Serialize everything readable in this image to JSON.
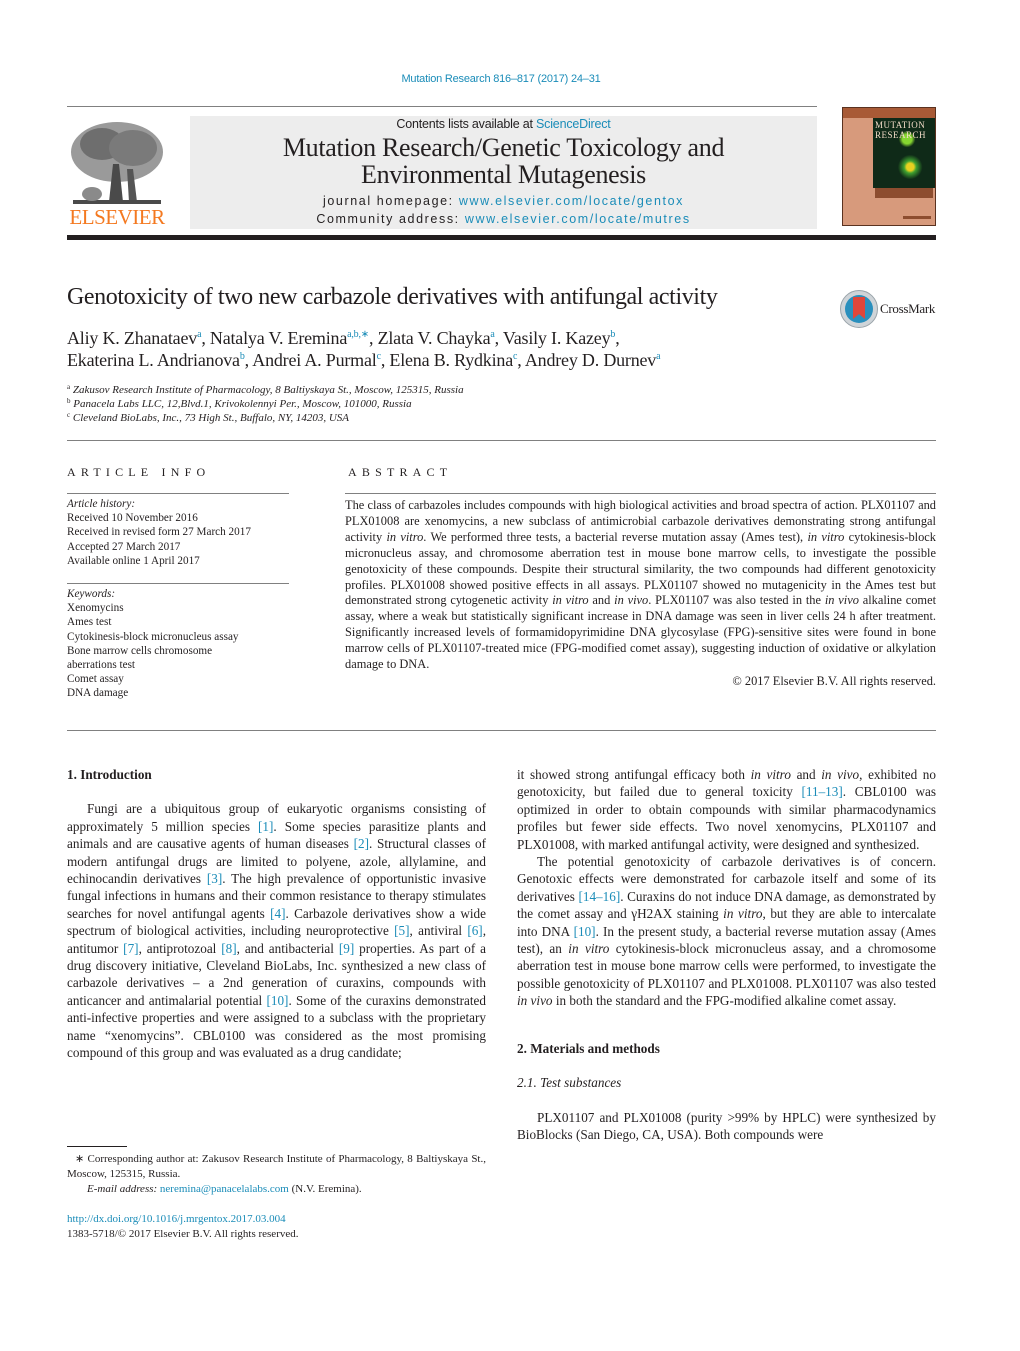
{
  "header": {
    "journal_ref": "Mutation Research 816–817 (2017) 24–31",
    "contents_prefix": "Contents lists available at ",
    "contents_link": "ScienceDirect",
    "journal_title_line1": "Mutation Research/Genetic Toxicology and",
    "journal_title_line2": "Environmental Mutagenesis",
    "homepage_label": "journal homepage: ",
    "homepage_url": "www.elsevier.com/locate/gentox",
    "community_label": "Community address: ",
    "community_url": "www.elsevier.com/locate/mutres",
    "publisher_logo_text": "ELSEVIER",
    "cover_title_line1": "MUTATION",
    "cover_title_line2": "RESEARCH"
  },
  "article": {
    "title": "Genotoxicity of two new carbazole derivatives with antifungal activity",
    "crossmark_label": "CrossMark",
    "authors": [
      {
        "name": "Aliy K. Zhanataev",
        "aff": "a",
        "sep": ", "
      },
      {
        "name": "Natalya V. Eremina",
        "aff": "a,b,∗",
        "sep": ", "
      },
      {
        "name": "Zlata V. Chayka",
        "aff": "a",
        "sep": ", "
      },
      {
        "name": "Vasily I. Kazey",
        "aff": "b",
        "sep": ","
      },
      {
        "name": "Ekaterina L. Andrianova",
        "aff": "b",
        "sep": ", "
      },
      {
        "name": "Andrei A. Purmal",
        "aff": "c",
        "sep": ", "
      },
      {
        "name": "Elena B. Rydkina",
        "aff": "c",
        "sep": ", "
      },
      {
        "name": "Andrey D. Durnev",
        "aff": "a",
        "sep": ""
      }
    ],
    "affiliations": [
      {
        "key": "a",
        "text": "Zakusov Research Institute of Pharmacology, 8 Baltiyskaya St., Moscow, 125315, Russia"
      },
      {
        "key": "b",
        "text": "Panacela Labs LLC, 12,Blvd.1, Krivokolennyi Per., Moscow, 101000, Russia"
      },
      {
        "key": "c",
        "text": "Cleveland BioLabs, Inc., 73 High St., Buffalo, NY, 14203, USA"
      }
    ]
  },
  "article_info": {
    "heading": "ARTICLE INFO",
    "history_label": "Article history:",
    "history": [
      "Received 10 November 2016",
      "Received in revised form 27 March 2017",
      "Accepted 27 March 2017",
      "Available online 1 April 2017"
    ],
    "keywords_label": "Keywords:",
    "keywords": [
      "Xenomycins",
      "Ames test",
      "Cytokinesis-block micronucleus assay",
      "Bone marrow cells chromosome",
      "aberrations test",
      "Comet assay",
      "DNA damage"
    ]
  },
  "abstract": {
    "heading": "ABSTRACT",
    "segments": [
      {
        "t": "The class of carbazoles includes compounds with high biological activities and broad spectra of action. PLX01107 and PLX01008 are xenomycins, a new subclass of antimicrobial carbazole derivatives demonstrating strong antifungal activity ",
        "i": false
      },
      {
        "t": "in vitro",
        "i": true
      },
      {
        "t": ". We performed three tests, a bacterial reverse mutation assay (Ames test), ",
        "i": false
      },
      {
        "t": "in vitro",
        "i": true
      },
      {
        "t": " cytokinesis-block micronucleus assay, and chromosome aberration test in mouse bone marrow cells, to investigate the possible genotoxicity of these compounds. Despite their structural similarity, the two compounds had different genotoxicity profiles. PLX01008 showed positive effects in all assays. PLX01107 showed no mutagenicity in the Ames test but demonstrated strong cytogenetic activity ",
        "i": false
      },
      {
        "t": "in vitro",
        "i": true
      },
      {
        "t": " and ",
        "i": false
      },
      {
        "t": "in vivo",
        "i": true
      },
      {
        "t": ". PLX01107 was also tested in the ",
        "i": false
      },
      {
        "t": "in vivo",
        "i": true
      },
      {
        "t": " alkaline comet assay, where a weak but statistically significant increase in DNA damage was seen in liver cells 24 h after treatment. Significantly increased levels of formamidopyrimidine DNA glycosylase (FPG)-sensitive sites were found in bone marrow cells of PLX01107-treated mice (FPG-modified comet assay), suggesting induction of oxidative or alkylation damage to DNA.",
        "i": false
      }
    ],
    "copyright": "© 2017 Elsevier B.V. All rights reserved."
  },
  "body": {
    "intro_heading": "1.  Introduction",
    "left_col": [
      {
        "t": "Fungi are a ubiquitous group of eukaryotic organisms consisting of approximately 5 million species ",
        "k": "text"
      },
      {
        "t": "[1]",
        "k": "ref"
      },
      {
        "t": ". Some species parasitize plants and animals and are causative agents of human diseases ",
        "k": "text"
      },
      {
        "t": "[2]",
        "k": "ref"
      },
      {
        "t": ". Structural classes of modern antifungal drugs are limited to polyene, azole, allylamine, and echinocandin derivatives ",
        "k": "text"
      },
      {
        "t": "[3]",
        "k": "ref"
      },
      {
        "t": ". The high prevalence of opportunistic invasive fungal infections in humans and their common resistance to therapy stimulates searches for novel antifungal agents ",
        "k": "text"
      },
      {
        "t": "[4]",
        "k": "ref"
      },
      {
        "t": ". Carbazole derivatives show a wide spectrum of biological activities, including neuroprotective ",
        "k": "text"
      },
      {
        "t": "[5]",
        "k": "ref"
      },
      {
        "t": ", antiviral ",
        "k": "text"
      },
      {
        "t": "[6]",
        "k": "ref"
      },
      {
        "t": ", antitumor ",
        "k": "text"
      },
      {
        "t": "[7]",
        "k": "ref"
      },
      {
        "t": ", antiprotozoal ",
        "k": "text"
      },
      {
        "t": "[8]",
        "k": "ref"
      },
      {
        "t": ", and antibacterial ",
        "k": "text"
      },
      {
        "t": "[9]",
        "k": "ref"
      },
      {
        "t": " properties. As part of a drug discovery initiative, Cleveland BioLabs, Inc. synthesized a new class of carbazole derivatives – a 2nd generation of curaxins, compounds with anticancer and antimalarial potential ",
        "k": "text"
      },
      {
        "t": "[10]",
        "k": "ref"
      },
      {
        "t": ". Some of the curaxins demonstrated anti-infective properties and were assigned to a subclass with the proprietary name “xenomycins”. CBL0100 was considered as the most promising compound of this group and was evaluated as a drug candidate;",
        "k": "text"
      }
    ],
    "right_p1": [
      {
        "t": "it showed strong antifungal efficacy both ",
        "k": "text"
      },
      {
        "t": "in vitro",
        "k": "ital"
      },
      {
        "t": " and ",
        "k": "text"
      },
      {
        "t": "in vivo",
        "k": "ital"
      },
      {
        "t": ", exhibited no genotoxicity, but failed due to general toxicity ",
        "k": "text"
      },
      {
        "t": "[11–13]",
        "k": "ref"
      },
      {
        "t": ". CBL0100 was optimized in order to obtain compounds with similar pharmacodynamics profiles but fewer side effects. Two novel xenomycins, PLX01107 and PLX01008, with marked antifungal activity, were designed and synthesized.",
        "k": "text"
      }
    ],
    "right_p2": [
      {
        "t": "The potential genotoxicity of carbazole derivatives is of concern. Genotoxic effects were demonstrated for carbazole itself and some of its derivatives ",
        "k": "text"
      },
      {
        "t": "[14–16]",
        "k": "ref"
      },
      {
        "t": ". Curaxins do not induce DNA damage, as demonstrated by the comet assay and γH2AX staining ",
        "k": "text"
      },
      {
        "t": "in vitro",
        "k": "ital"
      },
      {
        "t": ", but they are able to intercalate into DNA ",
        "k": "text"
      },
      {
        "t": "[10]",
        "k": "ref"
      },
      {
        "t": ". In the present study, a bacterial reverse mutation assay (Ames test), an ",
        "k": "text"
      },
      {
        "t": "in vitro",
        "k": "ital"
      },
      {
        "t": " cytokinesis-block micronucleus assay, and a chromosome aberration test in mouse bone marrow cells were performed, to investigate the possible genotoxicity of PLX01107 and PLX01008. PLX01107 was also tested ",
        "k": "text"
      },
      {
        "t": "in vivo",
        "k": "ital"
      },
      {
        "t": " in both the standard and the FPG-modified alkaline comet assay.",
        "k": "text"
      }
    ],
    "methods_heading": "2.  Materials and methods",
    "subsection_heading": "2.1.  Test substances",
    "methods_p1": "PLX01107 and PLX01008 (purity >99% by HPLC) were synthesized by BioBlocks (San Diego, CA, USA). Both compounds were"
  },
  "footnote": {
    "corresponding": "∗  Corresponding author at: Zakusov Research Institute of Pharmacology, 8 Baltiyskaya St., Moscow, 125315, Russia.",
    "email_label": "E-mail address: ",
    "email": "neremina@panacelalabs.com",
    "email_suffix": " (N.V. Eremina).",
    "doi": "http://dx.doi.org/10.1016/j.mrgentox.2017.03.004",
    "issn": "1383-5718/© 2017 Elsevier B.V. All rights reserved."
  },
  "colors": {
    "link": "#1a8cb8",
    "elsevier_orange": "#f47920",
    "banner_bg": "#ededed",
    "text": "#231f20"
  }
}
